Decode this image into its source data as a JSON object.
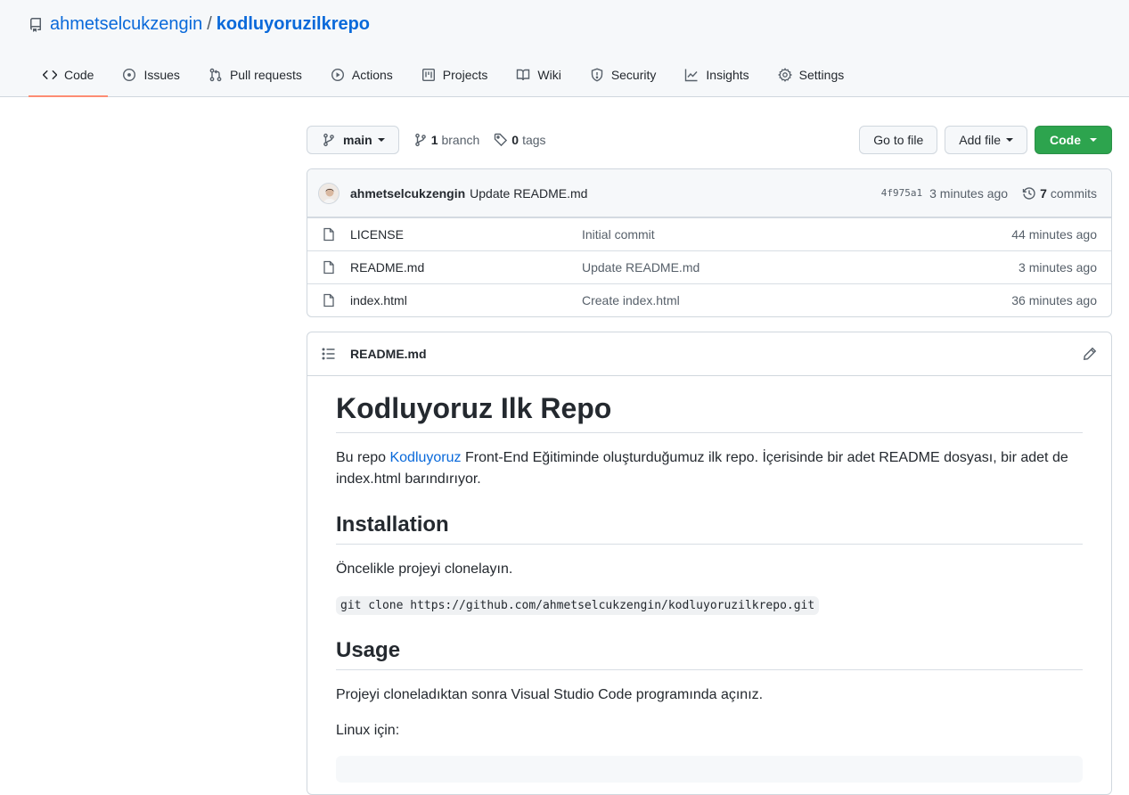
{
  "repo": {
    "owner": "ahmetselcukzengin",
    "separator": "/",
    "name": "kodluyoruzilkrepo"
  },
  "tabs": [
    {
      "label": "Code",
      "icon": "code-icon"
    },
    {
      "label": "Issues",
      "icon": "issue-opened-icon"
    },
    {
      "label": "Pull requests",
      "icon": "git-pull-request-icon"
    },
    {
      "label": "Actions",
      "icon": "play-icon"
    },
    {
      "label": "Projects",
      "icon": "project-icon"
    },
    {
      "label": "Wiki",
      "icon": "book-icon"
    },
    {
      "label": "Security",
      "icon": "shield-icon"
    },
    {
      "label": "Insights",
      "icon": "graph-icon"
    },
    {
      "label": "Settings",
      "icon": "gear-icon"
    }
  ],
  "toolbar": {
    "branch": "main",
    "branch_count": "1",
    "branch_label": "branch",
    "tag_count": "0",
    "tag_label": "tags",
    "go_to_file": "Go to file",
    "add_file": "Add file",
    "code": "Code"
  },
  "latest_commit": {
    "author": "ahmetselcukzengin",
    "message": "Update README.md",
    "sha": "4f975a1",
    "age": "3 minutes ago",
    "commit_count": "7",
    "commit_label": "commits"
  },
  "files": [
    {
      "name": "LICENSE",
      "commit": "Initial commit",
      "age": "44 minutes ago"
    },
    {
      "name": "README.md",
      "commit": "Update README.md",
      "age": "3 minutes ago"
    },
    {
      "name": "index.html",
      "commit": "Create index.html",
      "age": "36 minutes ago"
    }
  ],
  "readme": {
    "filename": "README.md",
    "h1": "Kodluyoruz Ilk Repo",
    "intro_before": "Bu repo ",
    "intro_link": "Kodluyoruz",
    "intro_after": " Front-End Eğitiminde oluşturduğumuz ilk repo. İçerisinde bir adet README dosyası, bir adet de index.html barındırıyor.",
    "h2_installation": "Installation",
    "installation_text": "Öncelikle projeyi clonelayın.",
    "clone_command": "git clone https://github.com/ahmetselcukzengin/kodluyoruzilkrepo.git",
    "h2_usage": "Usage",
    "usage_text": "Projeyi cloneladıktan sonra Visual Studio Code programında açınız.",
    "linux_text": "Linux için:"
  },
  "colors": {
    "link": "#0969da",
    "primary_button": "#2da44e",
    "tab_underline": "#fd8c73"
  }
}
